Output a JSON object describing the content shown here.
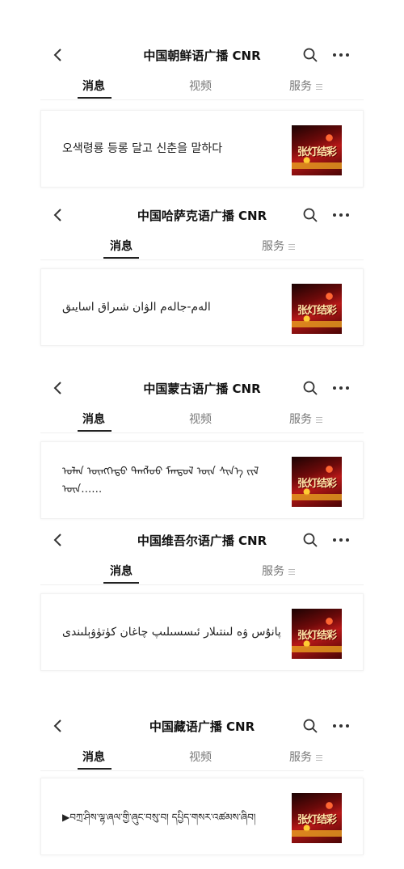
{
  "panels": [
    {
      "title": "中国朝鲜语广播 CNR",
      "tabs": [
        "消息",
        "视频",
        "服务"
      ],
      "message": "오색령룡 등롱 달고 신춘을 말하다"
    },
    {
      "title": "中国哈萨克语广播 CNR",
      "tabs": [
        "消息",
        "服务"
      ],
      "message": "الەم-جالەم الۋان شىراق اسايىق"
    },
    {
      "title": "中国蒙古语广播 CNR",
      "tabs": [
        "消息",
        "视频",
        "服务"
      ],
      "message": "ᠣᠯᠠᠨ ᠥᠩᠭᠡᠲᠦ ᠳᠡᠩᠯᠦᠦ ᠮᠠᠨᠳᠤᠯ ᠦᠨ ᠰᠢᠨ᠎ᠡ ᠵᠢᠯ ᠦᠨ……"
    },
    {
      "title": "中国维吾尔语广播 CNR",
      "tabs": [
        "消息",
        "服务"
      ],
      "message": "پانۇس ۋە لىنتىلار ئىسسىلىپ چاغان كۈتۈۋېلىندى"
    },
    {
      "title": "中国藏语广播 CNR",
      "tabs": [
        "消息",
        "视频",
        "服务"
      ],
      "message": "▶བཀྲ་ཤིས་ལྷ་ཞལ་གྱི་ཞུང་བསུ་བ། དཔྱིད་གསར་འཚམས་ཞིབ།"
    }
  ],
  "thumbnail_text": "张灯结彩",
  "icons": {
    "back": "chevron-left-icon",
    "search": "search-icon",
    "more": "more-dots-icon",
    "menu": "menu-icon"
  },
  "colors": {
    "thumb_red": "#b71818",
    "text_dark": "#222222",
    "tab_inactive": "#777777"
  }
}
